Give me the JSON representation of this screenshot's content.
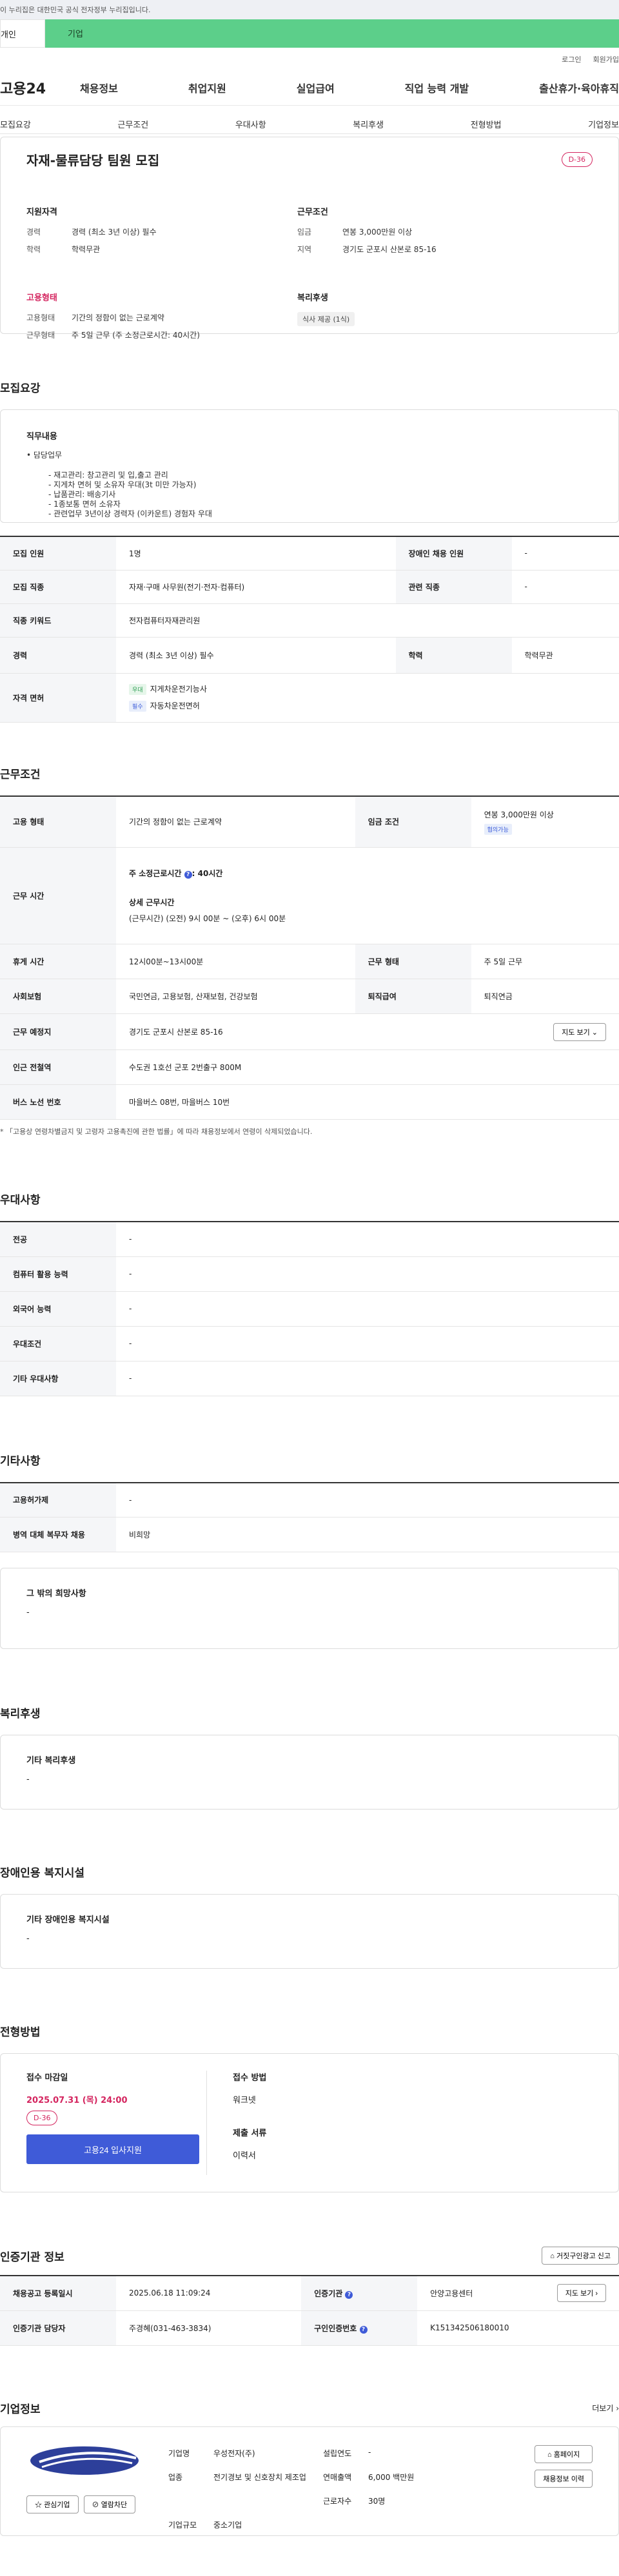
{
  "gov_banner": "이 누리집은 대한민국 공식 전자정부 누리집입니다.",
  "audience_tabs": [
    "개인",
    "기업"
  ],
  "util_links": [
    "로그인",
    "회원가입"
  ],
  "logo": "고용24",
  "gnb": [
    "채용정보",
    "취업지원",
    "실업급여",
    "직업 능력 개발",
    "출산휴가·육아휴직"
  ],
  "subnav": [
    "모집요강",
    "근무조건",
    "우대사항",
    "복리후생",
    "전형방법",
    "기업정보"
  ],
  "summary": {
    "title": "자재-물류담당 팀원 모집",
    "dday": "D-36",
    "qual_title": "지원자격",
    "career_k": "경력",
    "career_v": "경력 (최소 3년 이상) 필수",
    "edu_k": "학력",
    "edu_v": "학력무관",
    "work_title": "근무조건",
    "wage_k": "임금",
    "wage_v": "연봉 3,000만원 이상",
    "region_k": "지역",
    "region_v": "경기도 군포시 산본로 85-16",
    "emp_title": "고용형태",
    "type_k": "고용형태",
    "type_v": "기간의 정함이 없는 근로계약",
    "hours_k": "근무형태",
    "hours_v": "주 5일 근무 (주 소정근로시간: 40시간)",
    "welfare_title": "복리후생",
    "welfare_chip": "식사 제공 (1식)"
  },
  "recruit": {
    "title": "모집요강",
    "duty_title": "직무내용",
    "duty_lines": [
      "• 담당업무",
      "- 재고관리: 창고관리 및 입,출고 관리",
      "- 지게차 면허 및 소유자 우대(3t 미만 가능자)",
      "- 납품관리: 배송기사",
      "- 1종보통 면허 소유자",
      "- 관련업무 3년이상 경력자 (이카운트) 경험자 우대"
    ],
    "count_k": "모집 인원",
    "count_v": "1명",
    "disabled_k": "장애인 채용 인원",
    "disabled_v": "-",
    "job_k": "모집 직종",
    "job_v": "자재·구매 사무원(전기·전자·컴퓨터)",
    "related_k": "관련 직종",
    "related_v": "-",
    "keyword_k": "직종 키워드",
    "keyword_v": "전자컴퓨터자재관리원",
    "career_k": "경력",
    "career_v": "경력 (최소 3년 이상) 필수",
    "edu_k": "학력",
    "edu_v": "학력무관",
    "license_k": "자격 면허",
    "lic1_tag": "우대",
    "lic1": "지게차운전기능사",
    "lic2_tag": "필수",
    "lic2": "자동차운전면허"
  },
  "conditions": {
    "title": "근무조건",
    "emp_k": "고용 형태",
    "emp_v": "기간의 정함이 없는 근로계약",
    "wage_k": "임금 조건",
    "wage_v": "연봉 3,000만원 이상",
    "wage_tag": "협의가능",
    "time_k": "근무 시간",
    "time_main": "주 소정근로시간",
    "time_hours": "40시간",
    "time_detail_t": "상세 근무시간",
    "time_detail": "(근무시간) (오전) 9시 00분 ~ (오후) 6시 00분",
    "break_k": "휴게 시간",
    "break_v": "12시00분~13시00분",
    "form_k": "근무 형태",
    "form_v": "주 5일 근무",
    "ins_k": "사회보험",
    "ins_v": "국민연금, 고용보험, 산재보험, 건강보험",
    "ret_k": "퇴직급여",
    "ret_v": "퇴직연금",
    "place_k": "근무 예정지",
    "place_v": "경기도 군포시 산본로 85-16",
    "map_btn": "지도 보기",
    "subway_k": "인근 전철역",
    "subway_v": "수도권 1호선 군포 2번출구 800M",
    "bus_k": "버스 노선 번호",
    "bus_v": "마을버스 08번, 마을버스 10번",
    "note": "* 「고용상 연령차별금지 및 고령자 고용촉진에 관한 법률」에 따라 채용정보에서 연령이 삭제되었습니다."
  },
  "preference": {
    "title": "우대사항",
    "rows": [
      [
        "전공",
        "-"
      ],
      [
        "컴퓨터 활용 능력",
        "-"
      ],
      [
        "외국어 능력",
        "-"
      ],
      [
        "우대조건",
        "-"
      ],
      [
        "기타 우대사항",
        "-"
      ]
    ]
  },
  "etc": {
    "title": "기타사항",
    "rows": [
      [
        "고용허가제",
        "-"
      ],
      [
        "병역 대체 복무자 채용",
        "비희망"
      ]
    ],
    "wish_t": "그 밖의 희망사항",
    "wish_v": "-"
  },
  "welfare": {
    "title": "복리후생",
    "box_t": "기타 복리후생",
    "box_v": "-"
  },
  "disabled": {
    "title": "장애인용 복지시설",
    "box_t": "기타 장애인용 복지시설",
    "box_v": "-"
  },
  "selection": {
    "title": "전형방법",
    "deadline_t": "접수 마감일",
    "deadline_v": "2025.07.31 (목) 24:00",
    "dday": "D-36",
    "apply": "고용24 입사지원",
    "method_t": "접수 방법",
    "method_v": "워크넷",
    "docs_t": "제출 서류",
    "docs_v": "이력서"
  },
  "agency": {
    "title": "인증기관 정보",
    "report_btn": "거짓구인광고 신고",
    "reg_k": "채용공고 등록일시",
    "reg_v": "2025.06.18 11:09:24",
    "org_k": "인증기관",
    "org_v": "안양고용센터",
    "map_btn": "지도 보기",
    "mgr_k": "인증기관 담당자",
    "mgr_v": "주경혜(031-463-3834)",
    "no_k": "구인인증번호",
    "no_v": "K151342506180010"
  },
  "company": {
    "title": "기업정보",
    "more": "더보기",
    "name_k": "기업명",
    "name_v": "우성전자(주)",
    "year_k": "설립연도",
    "year_v": "-",
    "ind_k": "업종",
    "ind_v": "전기경보 및 신호장치 제조업",
    "sales_k": "연매출액",
    "sales_v": "6,000 백만원",
    "emp_k": "근로자수",
    "emp_v": "30명",
    "size_k": "기업규모",
    "size_v": "중소기업",
    "home_btn": "홈페이지",
    "jobs_btn": "채용정보 이력",
    "fav_btn": "관심기업",
    "block_btn": "열람차단"
  }
}
